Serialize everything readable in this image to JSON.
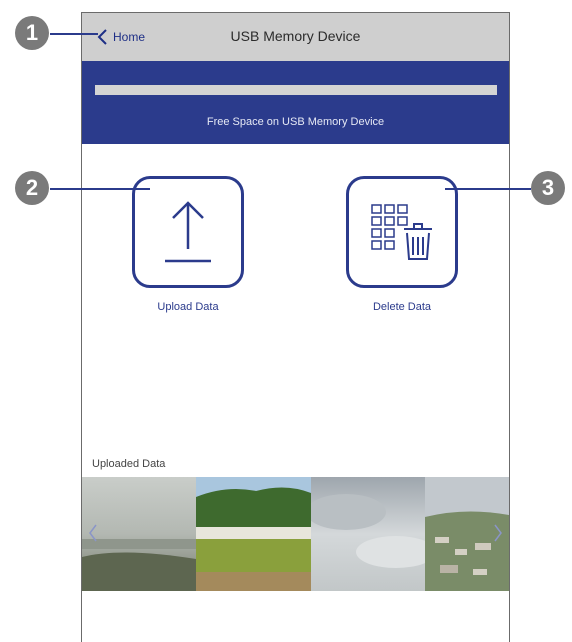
{
  "header": {
    "back_label": "Home",
    "title": "USB Memory Device"
  },
  "storage": {
    "label": "Free Space on USB Memory Device"
  },
  "actions": {
    "upload_label": "Upload Data",
    "delete_label": "Delete Data"
  },
  "uploaded": {
    "title": "Uploaded Data",
    "thumbnails": [
      "foggy-river-landscape",
      "green-field-with-trees",
      "cloudy-sky",
      "town-aerial-view"
    ]
  },
  "callouts": [
    "1",
    "2",
    "3"
  ],
  "colors": {
    "accent": "#2b3b8c",
    "navbar": "#cfcfcf",
    "callout": "#7a7a7a"
  },
  "icons": {
    "back": "chevron-left-icon",
    "upload": "upload-arrow-icon",
    "delete": "grid-trash-icon",
    "prev": "chevron-left-icon",
    "next": "chevron-right-icon"
  }
}
